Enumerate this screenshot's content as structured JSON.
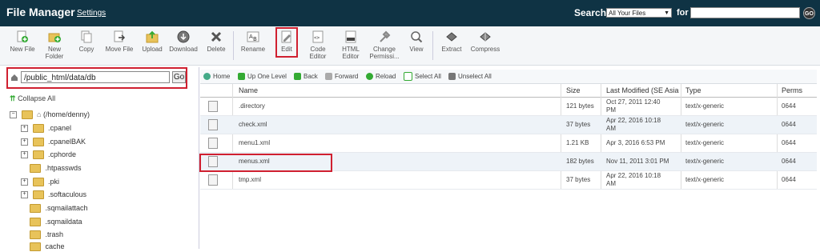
{
  "header": {
    "title": "File Manager",
    "settings_link": "Settings",
    "search_label": "Search",
    "search_scope": "All Your Files",
    "for_label": "for",
    "search_value": "",
    "go_button": "GO"
  },
  "toolbar": [
    {
      "name": "new-file",
      "label1": "New File",
      "label2": "",
      "icon": "new-file-icon"
    },
    {
      "name": "new-folder",
      "label1": "New",
      "label2": "Folder",
      "icon": "new-folder-icon"
    },
    {
      "name": "copy",
      "label1": "Copy",
      "label2": "",
      "icon": "copy-icon"
    },
    {
      "name": "move-file",
      "label1": "Move File",
      "label2": "",
      "icon": "move-icon"
    },
    {
      "name": "upload",
      "label1": "Upload",
      "label2": "",
      "icon": "upload-icon"
    },
    {
      "name": "download",
      "label1": "Download",
      "label2": "",
      "icon": "download-icon"
    },
    {
      "name": "delete",
      "label1": "Delete",
      "label2": "",
      "icon": "delete-icon"
    },
    {
      "name": "rename",
      "label1": "Rename",
      "label2": "",
      "icon": "rename-icon"
    },
    {
      "name": "edit",
      "label1": "Edit",
      "label2": "",
      "icon": "edit-icon"
    },
    {
      "name": "code-editor",
      "label1": "Code",
      "label2": "Editor",
      "icon": "code-editor-icon"
    },
    {
      "name": "html-editor",
      "label1": "HTML",
      "label2": "Editor",
      "icon": "html-editor-icon"
    },
    {
      "name": "change-permissions",
      "label1": "Change",
      "label2": "Permissi...",
      "icon": "permissions-icon"
    },
    {
      "name": "view",
      "label1": "View",
      "label2": "",
      "icon": "view-icon"
    },
    {
      "name": "extract",
      "label1": "Extract",
      "label2": "",
      "icon": "extract-icon"
    },
    {
      "name": "compress",
      "label1": "Compress",
      "label2": "",
      "icon": "compress-icon"
    }
  ],
  "left": {
    "path_value": "/public_html/data/db",
    "go_label": "Go",
    "collapse_all": "Collapse All",
    "tree": [
      {
        "label": "(/home/denny)",
        "expander": "−",
        "level": 0
      },
      {
        "label": ".cpanel",
        "expander": "+",
        "level": 1
      },
      {
        "label": ".cpanelBAK",
        "expander": "+",
        "level": 1
      },
      {
        "label": ".cphorde",
        "expander": "+",
        "level": 1
      },
      {
        "label": ".htpasswds",
        "expander": "",
        "level": 1
      },
      {
        "label": ".pki",
        "expander": "+",
        "level": 1
      },
      {
        "label": ".softaculous",
        "expander": "+",
        "level": 1
      },
      {
        "label": ".sqmailattach",
        "expander": "",
        "level": 1
      },
      {
        "label": ".sqmaildata",
        "expander": "",
        "level": 1
      },
      {
        "label": ".trash",
        "expander": "",
        "level": 1
      },
      {
        "label": "cache",
        "expander": "",
        "level": 1
      }
    ]
  },
  "nav": {
    "home": "Home",
    "up_one_level": "Up One Level",
    "back": "Back",
    "forward": "Forward",
    "reload": "Reload",
    "select_all": "Select All",
    "unselect_all": "Unselect All"
  },
  "table": {
    "headers": {
      "name": "Name",
      "size": "Size",
      "modified": "Last Modified (SE Asia S",
      "type": "Type",
      "perms": "Perms"
    },
    "rows": [
      {
        "name": ".directory",
        "size": "121 bytes",
        "modified1": "Oct 27, 2011 12:40",
        "modified2": "PM",
        "type": "text/x-generic",
        "perms": "0644"
      },
      {
        "name": "check.xml",
        "size": "37 bytes",
        "modified1": "Apr 22, 2016 10:18",
        "modified2": "AM",
        "type": "text/x-generic",
        "perms": "0644"
      },
      {
        "name": "menu1.xml",
        "size": "1.21 KB",
        "modified1": "Apr 3, 2016 6:53 PM",
        "modified2": "",
        "type": "text/x-generic",
        "perms": "0644"
      },
      {
        "name": "menus.xml",
        "size": "182 bytes",
        "modified1": "Nov 11, 2011 3:01 PM",
        "modified2": "",
        "type": "text/x-generic",
        "perms": "0644"
      },
      {
        "name": "tmp.xml",
        "size": "37 bytes",
        "modified1": "Apr 22, 2016 10:18",
        "modified2": "AM",
        "type": "text/x-generic",
        "perms": "0644"
      }
    ]
  },
  "colors": {
    "header_bg": "#0f3344",
    "highlight": "#d02030",
    "row_alt": "#eef3f8"
  }
}
